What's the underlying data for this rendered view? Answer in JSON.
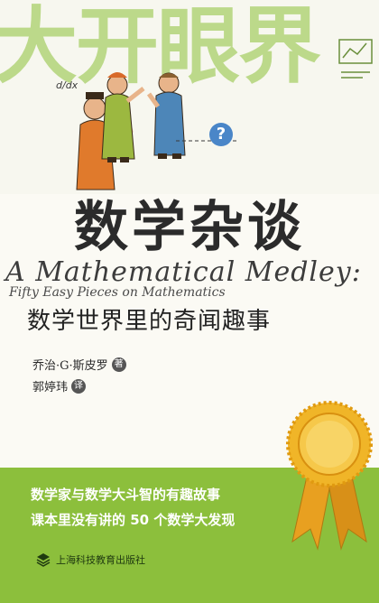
{
  "series": {
    "title": "大开眼界"
  },
  "doodles": {
    "left_formula": "d/dx",
    "right_note": ""
  },
  "illustration": {
    "badge": "?"
  },
  "book": {
    "title": "数学杂谈",
    "title_en": "A Mathematical Medley:",
    "subtitle_en": "Fifty Easy Pieces on Mathematics",
    "subtitle": "数学世界里的奇闻趣事"
  },
  "credits": {
    "author": "乔治·G·斯皮罗",
    "author_role": "著",
    "translator": "郭婷玮",
    "translator_role": "译"
  },
  "features": [
    "数学家与数学大斗智的有趣故事",
    "课本里没有讲的 50 个数学大发现"
  ],
  "publisher": {
    "name": "上海科技教育出版社"
  },
  "colors": {
    "series_green": "#bcd98a",
    "band_green": "#8cbf3c",
    "medal_gold": "#f0b528",
    "badge_blue": "#4a86c8"
  }
}
